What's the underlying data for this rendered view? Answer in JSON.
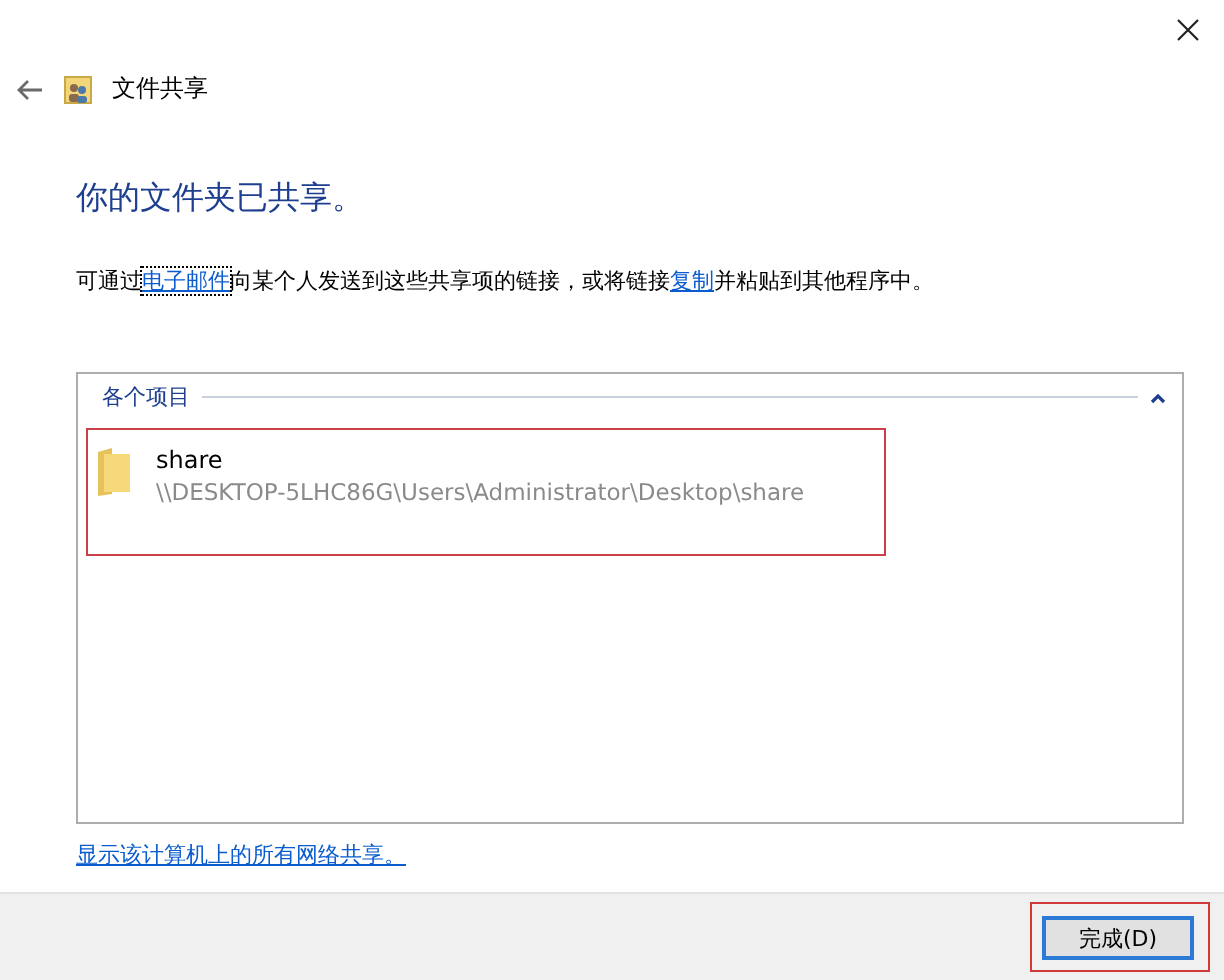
{
  "window": {
    "title": "文件共享"
  },
  "heading": "你的文件夹已共享。",
  "description": [
    {
      "kind": "text",
      "text": "可通过"
    },
    {
      "kind": "link",
      "text": "电子邮件",
      "focused": true
    },
    {
      "kind": "text",
      "text": "向某个人发送到这些共享项的链接，或将链接"
    },
    {
      "kind": "link",
      "text": "复制",
      "focused": false
    },
    {
      "kind": "text",
      "text": "并粘贴到其他程序中。"
    }
  ],
  "group": {
    "title": "各个项目",
    "expanded": true,
    "items": [
      {
        "name": "share",
        "path": "\\\\DESKTOP-5LHC86G\\Users\\Administrator\\Desktop\\share",
        "highlighted": true
      }
    ]
  },
  "show_all_link": "显示该计算机上的所有网络共享。",
  "buttons": [
    {
      "label": "完成(D)",
      "default": true,
      "highlighted": true
    }
  ]
}
